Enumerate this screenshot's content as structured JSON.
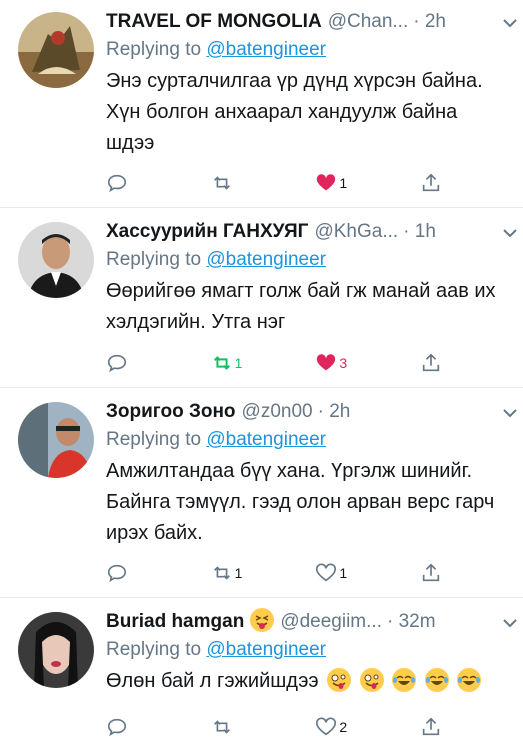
{
  "tweets": [
    {
      "name": "TRAVEL OF MONGOLIA",
      "handle": "@Chan...",
      "time": "· 2h",
      "replying_prefix": "Replying to",
      "replying_to": "@batengineer",
      "text": "Энэ сурталчилгаа үр дүнд хүрсэн байна. Хүн болгон анхаарал хандуулж байна шдээ",
      "retweets": "",
      "likes": "1",
      "retweeted": false,
      "liked": true
    },
    {
      "name": "Хассуурийн ГАНХУЯГ",
      "handle": "@KhGa...",
      "time": "· 1h",
      "replying_prefix": "Replying to",
      "replying_to": "@batengineer",
      "text": "Өөрийгөө ямагт голж бай гж манай аав их хэлдэгийн. Утга нэг",
      "retweets": "1",
      "likes": "3",
      "retweeted": true,
      "liked": true
    },
    {
      "name": "Зоригоо Зоно",
      "handle": "@z0n00",
      "time": "· 2h",
      "replying_prefix": "Replying to",
      "replying_to": "@batengineer",
      "text": "Амжилтандаа бүү хана. Үргэлж шинийг. Байнга тэмүүл. гээд олон арван верс гарч ирэх байх.",
      "retweets": "1",
      "likes": "1",
      "retweeted": false,
      "liked": false
    },
    {
      "name": "Buriad hamgan",
      "handle": "@deegiim...",
      "time": "· 32m",
      "replying_prefix": "Replying to",
      "replying_to": "@batengineer",
      "text": "Өлөн бай л гэжийшдээ",
      "retweets": "",
      "likes": "2",
      "retweeted": false,
      "liked": false
    }
  ],
  "colors": {
    "link": "#1b95e0",
    "muted": "#657786",
    "like_active": "#e0245e",
    "retweet_active": "#17bf63",
    "divider": "#e6ecf0"
  },
  "icons": [
    "reply-icon",
    "retweet-icon",
    "like-icon",
    "share-icon",
    "chevron-down-icon"
  ]
}
